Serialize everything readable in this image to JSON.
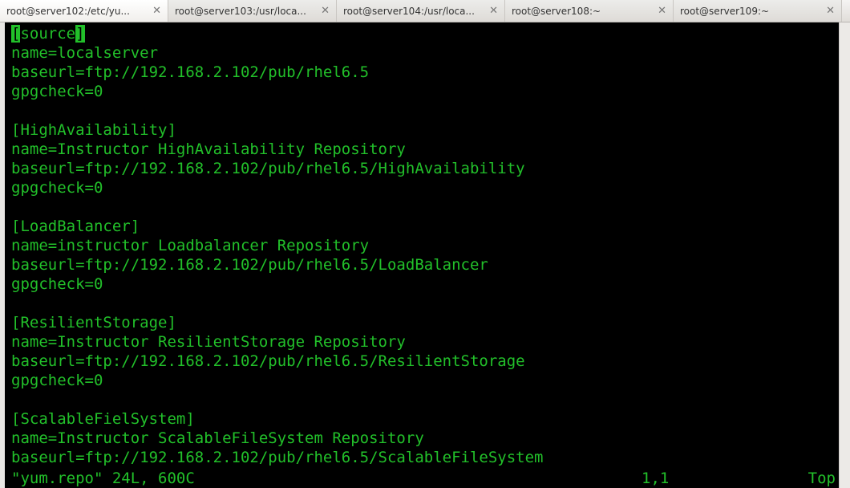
{
  "tabs": [
    {
      "label": "root@server102:/etc/yu...",
      "active": true
    },
    {
      "label": "root@server103:/usr/loca...",
      "active": false
    },
    {
      "label": "root@server104:/usr/loca...",
      "active": false
    },
    {
      "label": "root@server108:~",
      "active": false
    },
    {
      "label": "root@server109:~",
      "active": false
    }
  ],
  "editor": {
    "cursor_open": "[",
    "cursor_word": "source",
    "cursor_close": "]",
    "sections": [
      {
        "header": "",
        "lines": [
          "name=localserver",
          "baseurl=ftp://192.168.2.102/pub/rhel6.5",
          "gpgcheck=0",
          ""
        ]
      },
      {
        "header": "[HighAvailability]",
        "lines": [
          "name=Instructor HighAvailability Repository",
          "baseurl=ftp://192.168.2.102/pub/rhel6.5/HighAvailability",
          "gpgcheck=0",
          ""
        ]
      },
      {
        "header": "[LoadBalancer]",
        "lines": [
          "name=instructor Loadbalancer Repository",
          "baseurl=ftp://192.168.2.102/pub/rhel6.5/LoadBalancer",
          "gpgcheck=0",
          ""
        ]
      },
      {
        "header": "[ResilientStorage]",
        "lines": [
          "name=Instructor ResilientStorage Repository",
          "baseurl=ftp://192.168.2.102/pub/rhel6.5/ResilientStorage",
          "gpgcheck=0",
          ""
        ]
      },
      {
        "header": "[ScalableFielSystem]",
        "lines": [
          "name=Instructor ScalableFileSystem Repository",
          "baseurl=ftp://192.168.2.102/pub/rhel6.5/ScalableFileSystem"
        ]
      }
    ],
    "status": {
      "file": "\"yum.repo\" 24L, 600C",
      "pos": "1,1",
      "top": "Top"
    }
  }
}
